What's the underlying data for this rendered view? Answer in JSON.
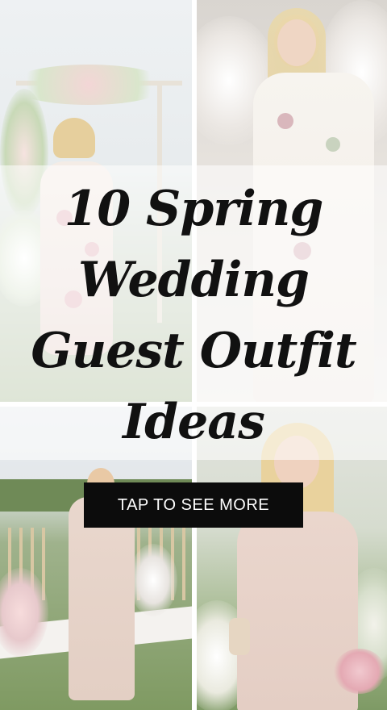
{
  "title": {
    "lines": [
      "10 Spring",
      "Wedding",
      "Guest Outfit",
      "Ideas"
    ]
  },
  "cta": {
    "label": "TAP TO SEE MORE"
  },
  "photos": [
    {
      "name": "photo-floral-dress-arch"
    },
    {
      "name": "photo-floral-dress-blossoms"
    },
    {
      "name": "photo-blush-gown-ceremony"
    },
    {
      "name": "photo-blush-gown-bouquet"
    }
  ],
  "colors": {
    "cta_background": "#0c0c0c",
    "cta_text": "#ffffff",
    "title_text": "#111111"
  }
}
